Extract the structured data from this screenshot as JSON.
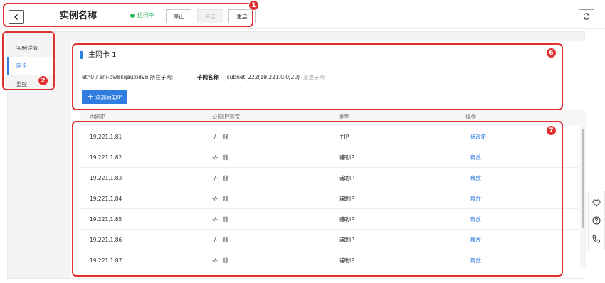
{
  "header": {
    "title": "实例名称",
    "status": "运行中",
    "stop_label": "停止",
    "start_label": "开启",
    "restart_label": "重启"
  },
  "sidebar": {
    "items": [
      {
        "label": "实例详情"
      },
      {
        "label": "网卡"
      },
      {
        "label": "监控"
      }
    ],
    "active_index": 1
  },
  "nic": {
    "title": "主网卡 1",
    "info_prefix": "eth0 / eni-bw8kqauxid9b 所在子网:",
    "subnet_name": "子网名称",
    "subnet_detail": "_subnet_222(19.221.0.0/20)",
    "change_subnet_label": "变更子网",
    "add_ip_label": "添加辅助IP"
  },
  "table": {
    "columns": [
      "内网IP",
      "公网IP/带宽",
      "类型",
      "操作"
    ],
    "rows": [
      {
        "ip": "19.221.1.81",
        "public": "-/-",
        "type": "主IP",
        "action": "修改IP"
      },
      {
        "ip": "19.221.1.82",
        "public": "-/-",
        "type": "辅助IP",
        "action": "释放"
      },
      {
        "ip": "19.221.1.83",
        "public": "-/-",
        "type": "辅助IP",
        "action": "释放"
      },
      {
        "ip": "19.221.1.84",
        "public": "-/-",
        "type": "辅助IP",
        "action": "释放"
      },
      {
        "ip": "19.221.1.85",
        "public": "-/-",
        "type": "辅助IP",
        "action": "释放"
      },
      {
        "ip": "19.221.1.86",
        "public": "-/-",
        "type": "辅助IP",
        "action": "释放"
      },
      {
        "ip": "19.221.1.87",
        "public": "-/-",
        "type": "辅助IP",
        "action": "释放"
      }
    ]
  },
  "annotations": [
    "1",
    "2",
    "6",
    "7"
  ],
  "colors": {
    "accent": "#2f7de1",
    "status": "#2db55d",
    "annotation": "#e03131"
  }
}
